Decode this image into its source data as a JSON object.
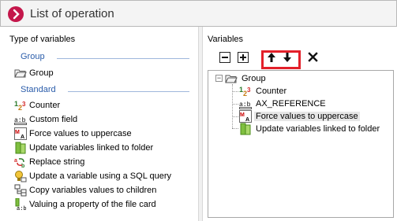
{
  "window": {
    "title": "List of operation"
  },
  "left_pane": {
    "label": "Type of variables",
    "sections": [
      {
        "heading": "Group",
        "items": [
          {
            "label": "Group",
            "icon": "folder-icon"
          }
        ]
      },
      {
        "heading": "Standard",
        "items": [
          {
            "label": "Counter",
            "icon": "counter-icon"
          },
          {
            "label": "Custom field",
            "icon": "text-field-icon"
          },
          {
            "label": "Force values to uppercase",
            "icon": "uppercase-icon"
          },
          {
            "label": "Update variables linked to folder",
            "icon": "linked-folder-icon"
          },
          {
            "label": "Replace string",
            "icon": "replace-icon"
          },
          {
            "label": "Update a variable using a SQL query",
            "icon": "sql-query-icon"
          },
          {
            "label": "Copy variables values to children",
            "icon": "copy-children-icon"
          },
          {
            "label": "Valuing a property of the file card",
            "icon": "file-card-property-icon"
          }
        ]
      }
    ]
  },
  "right_pane": {
    "label": "Variables",
    "toolbar": {
      "collapse": "collapse-icon",
      "expand": "expand-icon",
      "move_up": "arrow-up-icon",
      "move_down": "arrow-down-icon",
      "delete": "delete-icon"
    },
    "tree": {
      "root": {
        "label": "Group",
        "icon": "folder-open-icon",
        "expanded": true
      },
      "children": [
        {
          "label": "Counter",
          "icon": "counter-icon",
          "selected": false
        },
        {
          "label": "AX_REFERENCE",
          "icon": "text-field-icon",
          "selected": false
        },
        {
          "label": "Force values to uppercase",
          "icon": "uppercase-icon",
          "selected": true
        },
        {
          "label": "Update variables linked to folder",
          "icon": "linked-folder-icon",
          "selected": false
        }
      ]
    }
  },
  "colors": {
    "accent": "#c4174b",
    "section_heading": "#2a5caa",
    "highlight_box": "#e3202a"
  }
}
